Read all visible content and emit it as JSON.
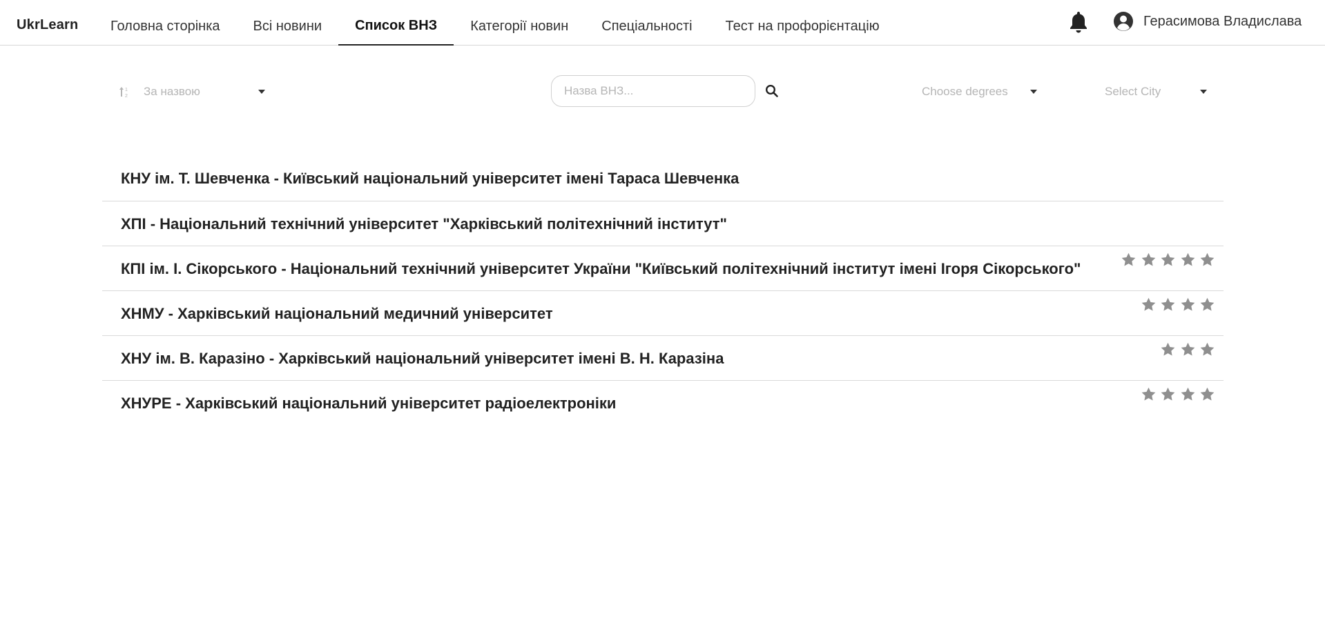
{
  "header": {
    "brand": "UkrLearn",
    "nav": [
      {
        "label": "Головна сторінка",
        "active": false
      },
      {
        "label": "Всі новини",
        "active": false
      },
      {
        "label": "Список ВНЗ",
        "active": true
      },
      {
        "label": "Категорії новин",
        "active": false
      },
      {
        "label": "Спеціальності",
        "active": false
      },
      {
        "label": "Тест на профорієнтацію",
        "active": false
      }
    ],
    "notification_icon": "bell-icon",
    "user": {
      "avatar_icon": "user-circle-icon",
      "name": "Герасимова Владислава"
    }
  },
  "filters": {
    "sort": {
      "icon": "sort-icon",
      "value": "За назвою"
    },
    "search": {
      "placeholder": "Назва ВНЗ...",
      "value": "",
      "icon": "search-icon"
    },
    "degrees": {
      "placeholder": "Choose degrees"
    },
    "city": {
      "placeholder": "Select City"
    }
  },
  "universities": [
    {
      "title": "КНУ ім. Т. Шевченка - Київський національний університет імені Тараса Шевченка",
      "rating": 0
    },
    {
      "title": "ХПІ - Національний технічний університет \"Харківський політехнічний інститут\"",
      "rating": 0
    },
    {
      "title": "КПІ ім. І. Сікорського - Національний технічний університет України \"Київський політехнічний інститут імені Ігоря Сікорського\"",
      "rating": 5
    },
    {
      "title": "ХНМУ - Харківський національний медичний університет",
      "rating": 4
    },
    {
      "title": "ХНУ ім. В. Каразіно - Харківський національний університет імені В. Н. Каразіна",
      "rating": 3
    },
    {
      "title": "ХНУРЕ - Харківський національний університет радіоелектроніки",
      "rating": 4
    }
  ],
  "colors": {
    "star": "#8f8f8f",
    "divider": "#d9d9d9",
    "placeholder": "#b5b5b5",
    "text": "#222222"
  }
}
